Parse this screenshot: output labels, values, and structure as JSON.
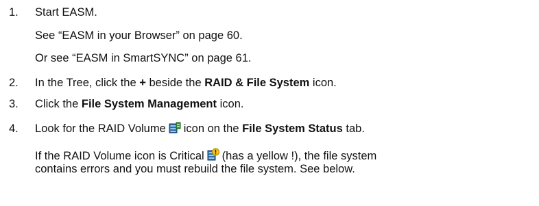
{
  "steps": [
    {
      "number": "1.",
      "text": "Start EASM.",
      "sub": [
        "See “EASM in your Browser” on page 60.",
        "Or see “EASM in SmartSYNC” on page 61."
      ]
    },
    {
      "number": "2.",
      "text_a": "In the Tree, click the ",
      "bold_a": "+",
      "text_b": " beside the ",
      "bold_b": "RAID & File System",
      "text_c": " icon."
    },
    {
      "number": "3.",
      "text_a": "Click the ",
      "bold_a": "File System Management",
      "text_b": " icon."
    },
    {
      "number": "4.",
      "text_a": "Look for the RAID Volume",
      "icon_name": "raid-volume-icon",
      "text_b": "icon on the ",
      "bold_a": "File System Status",
      "text_c": " tab."
    }
  ],
  "note": {
    "line1_a": "If the RAID Volume icon is Critical",
    "icon_name": "raid-volume-critical-icon",
    "line1_b": "(has a yellow !), the file system",
    "line2": "contains errors and you must rebuild the file system. See below."
  }
}
